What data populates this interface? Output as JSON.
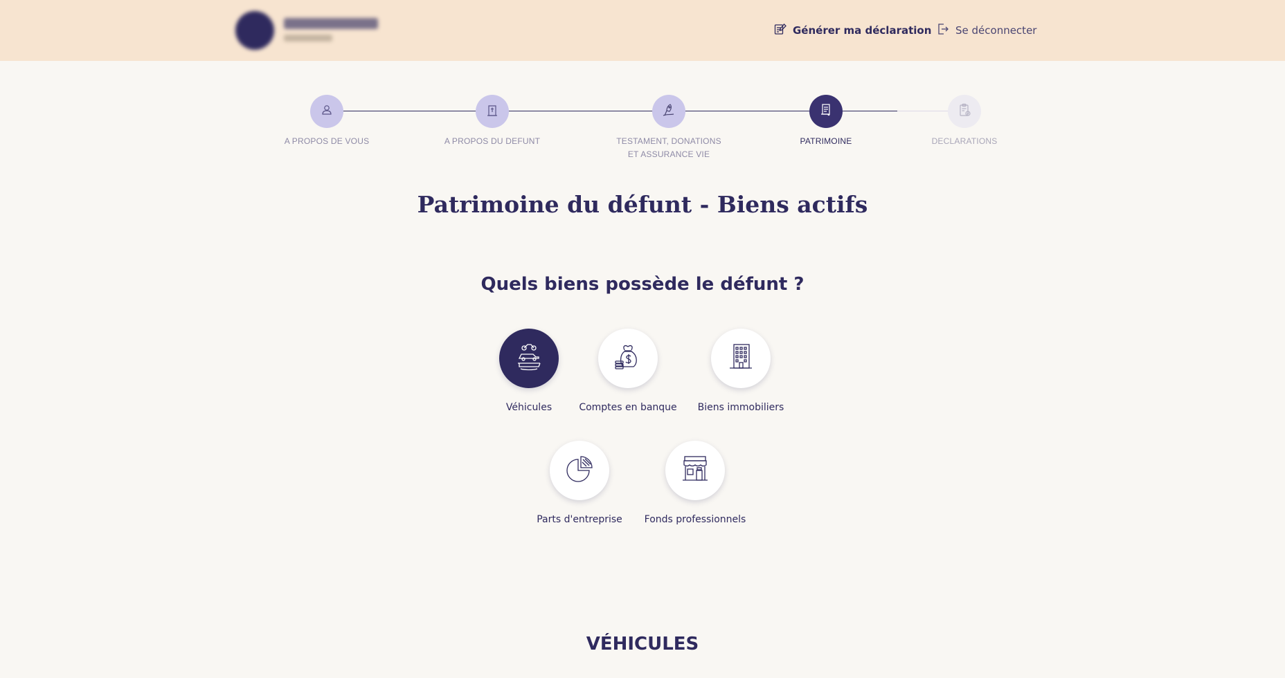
{
  "header": {
    "generate_label": "Générer ma déclaration",
    "logout_label": "Se déconnecter"
  },
  "stepper": {
    "steps": [
      {
        "label_line1": "A PROPOS DE VOUS",
        "label_line2": "",
        "state": "done",
        "icon": "person-icon"
      },
      {
        "label_line1": "A PROPOS DU DEFUNT",
        "label_line2": "",
        "state": "done",
        "icon": "tombstone-cross-icon"
      },
      {
        "label_line1": "TESTAMENT, DONATIONS",
        "label_line2": "ET ASSURANCE VIE",
        "state": "done",
        "icon": "quill-icon"
      },
      {
        "label_line1": "PATRIMOINE",
        "label_line2": "",
        "state": "active",
        "icon": "scroll-icon"
      },
      {
        "label_line1": "DECLARATIONS",
        "label_line2": "",
        "state": "disabled",
        "icon": "clipboard-check-icon"
      }
    ]
  },
  "page": {
    "title": "Patrimoine du défunt - Biens actifs",
    "question": "Quels biens possède le défunt ?"
  },
  "assets": [
    {
      "label": "Véhicules",
      "selected": true,
      "icon": "vehicles-icon"
    },
    {
      "label": "Comptes en banque",
      "selected": false,
      "icon": "money-bag-icon"
    },
    {
      "label": "Biens immobiliers",
      "selected": false,
      "icon": "building-icon"
    },
    {
      "label": "Parts d'entreprise",
      "selected": false,
      "icon": "pie-chart-icon"
    },
    {
      "label": "Fonds professionnels",
      "selected": false,
      "icon": "storefront-icon"
    }
  ],
  "section": {
    "heading": "VÉHICULES"
  },
  "colors": {
    "primary": "#2f2a5e",
    "header_bg": "#f7e4d0",
    "page_bg": "#f9f7f3",
    "step_done": "#cac6ea",
    "step_disabled": "#edebf1"
  }
}
